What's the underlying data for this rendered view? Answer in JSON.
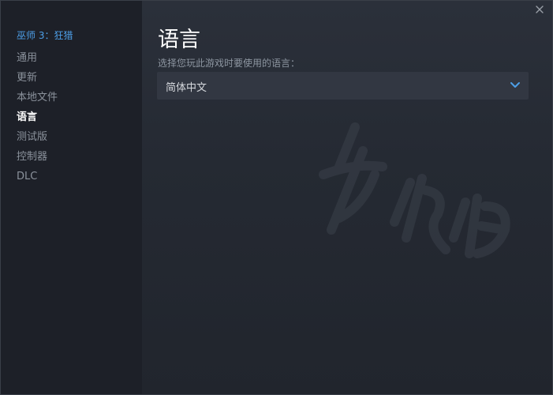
{
  "window": {
    "close_icon": "close-icon"
  },
  "sidebar": {
    "game_title": "巫师 3：狂猎",
    "items": [
      {
        "label": "通用",
        "active": false
      },
      {
        "label": "更新",
        "active": false
      },
      {
        "label": "本地文件",
        "active": false
      },
      {
        "label": "语言",
        "active": true
      },
      {
        "label": "测试版",
        "active": false
      },
      {
        "label": "控制器",
        "active": false
      },
      {
        "label": "DLC",
        "active": false
      }
    ]
  },
  "main": {
    "title": "语言",
    "prompt": "选择您玩此游戏时要使用的语言：",
    "language_select": {
      "value": "简体中文",
      "icon": "chevron-down-icon"
    }
  },
  "colors": {
    "accent": "#4d9fe8",
    "sidebar_bg": "#1d2028",
    "main_bg": "#252a33",
    "select_bg": "#323742"
  }
}
